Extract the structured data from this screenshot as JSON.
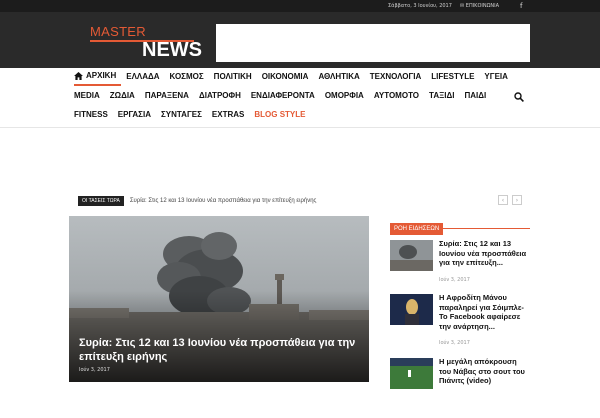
{
  "topbar": {
    "date": "Σάββατο, 3 Ιουνίου, 2017",
    "contact": "✉ ΕΠΙΚΟΙΝΩΝΙΑ",
    "facebook_icon": "f"
  },
  "logo": {
    "word1": "MASTER",
    "word2": "NEWS"
  },
  "nav": {
    "row1": [
      "ΑΡΧΙΚΗ",
      "ΕΛΛΑΔΑ",
      "ΚΟΣΜΟΣ",
      "ΠΟΛΙΤΙΚΗ",
      "ΟΙΚΟΝΟΜΙΑ",
      "ΑΘΛΗΤΙΚΑ",
      "ΤΕΧΝΟΛΟΓΙΑ",
      "LIFESTYLE",
      "ΥΓΕΙΑ"
    ],
    "row2": [
      "MEDIA",
      "ΖΩΔΙΑ",
      "ΠΑΡΑΞΕΝΑ",
      "ΔΙΑΤΡΟΦΗ",
      "ΕΝΔΙΑΦΕΡΟΝΤΑ",
      "ΟΜΟΡΦΙΑ",
      "ΑΥΤΟΜΟΤΟ",
      "ΤΑΞΙΔΙ",
      "ΠΑΙΔΙ"
    ],
    "row3": [
      "FITNESS",
      "ΕΡΓΑΣΙΑ",
      "ΣΥΝΤΑΓΕΣ",
      "EXTRAS",
      "BLOG STYLE"
    ]
  },
  "ticker": {
    "badge": "ΟΙ ΤΑΣΕΙΣ ΤΩΡΑ",
    "text": "Συρία: Στις 12 και 13 Ιουνίου νέα προσπάθεια για την επίτευξη ειρήνης",
    "prev": "‹",
    "next": "›"
  },
  "hero": {
    "title": "Συρία: Στις 12 και 13 Ιουνίου νέα προσπάθεια για την επίτευξη ειρήνης",
    "date": "Ιούν 3, 2017"
  },
  "sidebar": {
    "heading": "ΡΟΗ ΕΙΔΗΣΕΩΝ",
    "items": [
      {
        "title": "Συρία: Στις 12 και 13 Ιουνίου νέα προσπάθεια για την επίτευξη...",
        "date": "Ιούν 3, 2017"
      },
      {
        "title": "Η Αφροδίτη Μάνου παραληρεί για Σόιμπλε- Το Facebook αφαίρεσε την ανάρτηση...",
        "date": "Ιούν 3, 2017"
      },
      {
        "title": "Η μεγάλη απόκρουση του Νάβας στο σουτ του Πιάνιτς (video)",
        "date": ""
      }
    ]
  },
  "colors": {
    "accent": "#e45a35",
    "header_bg": "#2a2a2a",
    "topbar_bg": "#1c1c1c"
  }
}
